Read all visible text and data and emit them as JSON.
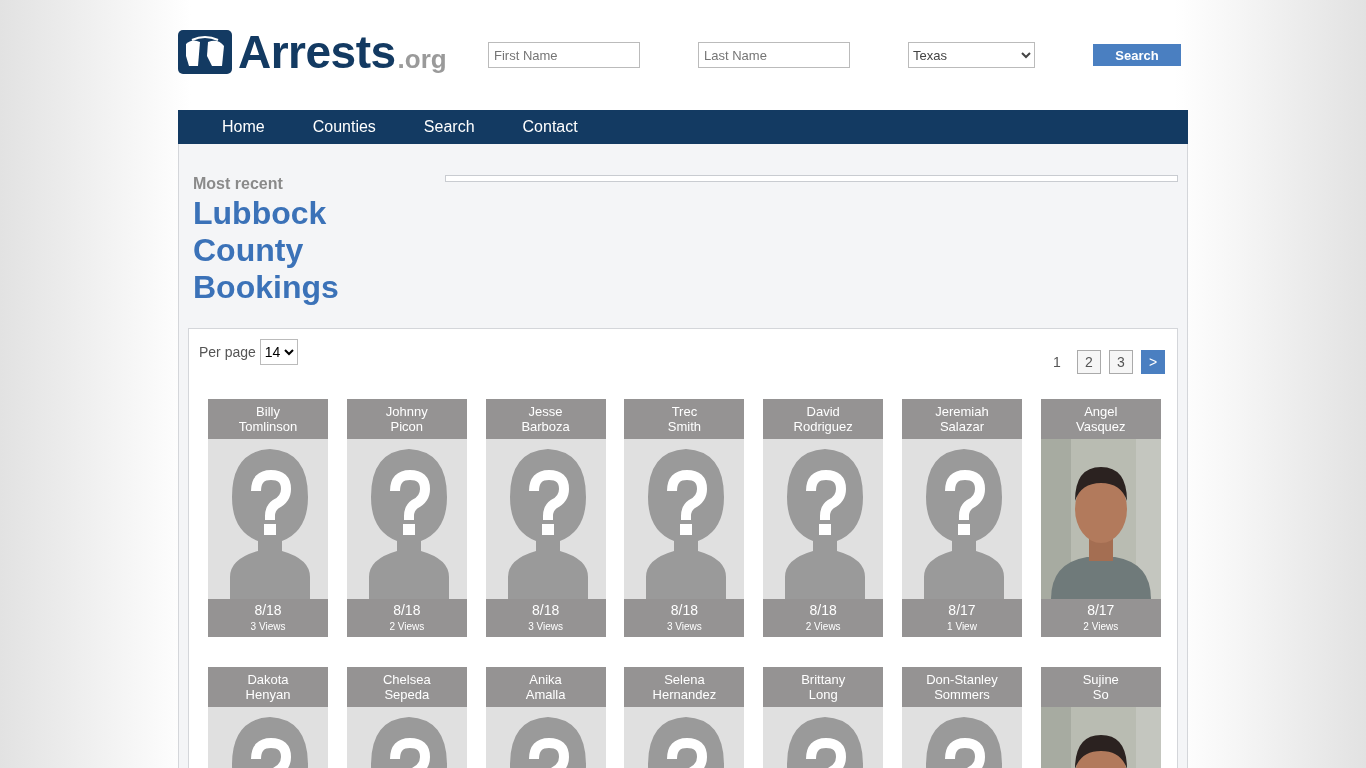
{
  "logo": {
    "name": "Arrests",
    "suffix": ".org"
  },
  "search": {
    "first_name": {
      "placeholder": "First Name"
    },
    "last_name": {
      "placeholder": "Last Name"
    },
    "state": "Texas",
    "button": "Search"
  },
  "nav": [
    "Home",
    "Counties",
    "Search",
    "Contact"
  ],
  "heading": {
    "eyebrow": "Most recent",
    "title_lines": [
      "Lubbock",
      "County",
      "Bookings"
    ]
  },
  "per_page": {
    "label": "Per page",
    "value": "14"
  },
  "pagination": [
    {
      "label": "1",
      "selected": true,
      "kind": "page"
    },
    {
      "label": "2",
      "selected": false,
      "kind": "page"
    },
    {
      "label": "3",
      "selected": false,
      "kind": "page"
    },
    {
      "label": ">",
      "selected": false,
      "kind": "next"
    }
  ],
  "bookings": [
    {
      "first": "Billy",
      "last": "Tomlinson",
      "kind": "placeholder",
      "date": "8/18",
      "views": "3 Views"
    },
    {
      "first": "Johnny",
      "last": "Picon",
      "kind": "placeholder",
      "date": "8/18",
      "views": "2 Views"
    },
    {
      "first": "Jesse",
      "last": "Barboza",
      "kind": "placeholder",
      "date": "8/18",
      "views": "3 Views"
    },
    {
      "first": "Trec",
      "last": "Smith",
      "kind": "placeholder",
      "date": "8/18",
      "views": "3 Views"
    },
    {
      "first": "David",
      "last": "Rodriguez",
      "kind": "placeholder",
      "date": "8/18",
      "views": "2 Views"
    },
    {
      "first": "Jeremiah",
      "last": "Salazar",
      "kind": "placeholder",
      "date": "8/17",
      "views": "1 View"
    },
    {
      "first": "Angel",
      "last": "Vasquez",
      "kind": "picture",
      "date": "8/17",
      "views": "2 Views"
    },
    {
      "first": "Dakota",
      "last": "Henyan",
      "kind": "placeholder"
    },
    {
      "first": "Chelsea",
      "last": "Sepeda",
      "kind": "placeholder"
    },
    {
      "first": "Anika",
      "last": "Amalla",
      "kind": "placeholder"
    },
    {
      "first": "Selena",
      "last": "Hernandez",
      "kind": "placeholder"
    },
    {
      "first": "Brittany",
      "last": "Long",
      "kind": "placeholder"
    },
    {
      "first": "Don-Stanley",
      "last": "Sommers",
      "kind": "placeholder"
    },
    {
      "first": "Sujine",
      "last": "So",
      "kind": "picture"
    }
  ]
}
